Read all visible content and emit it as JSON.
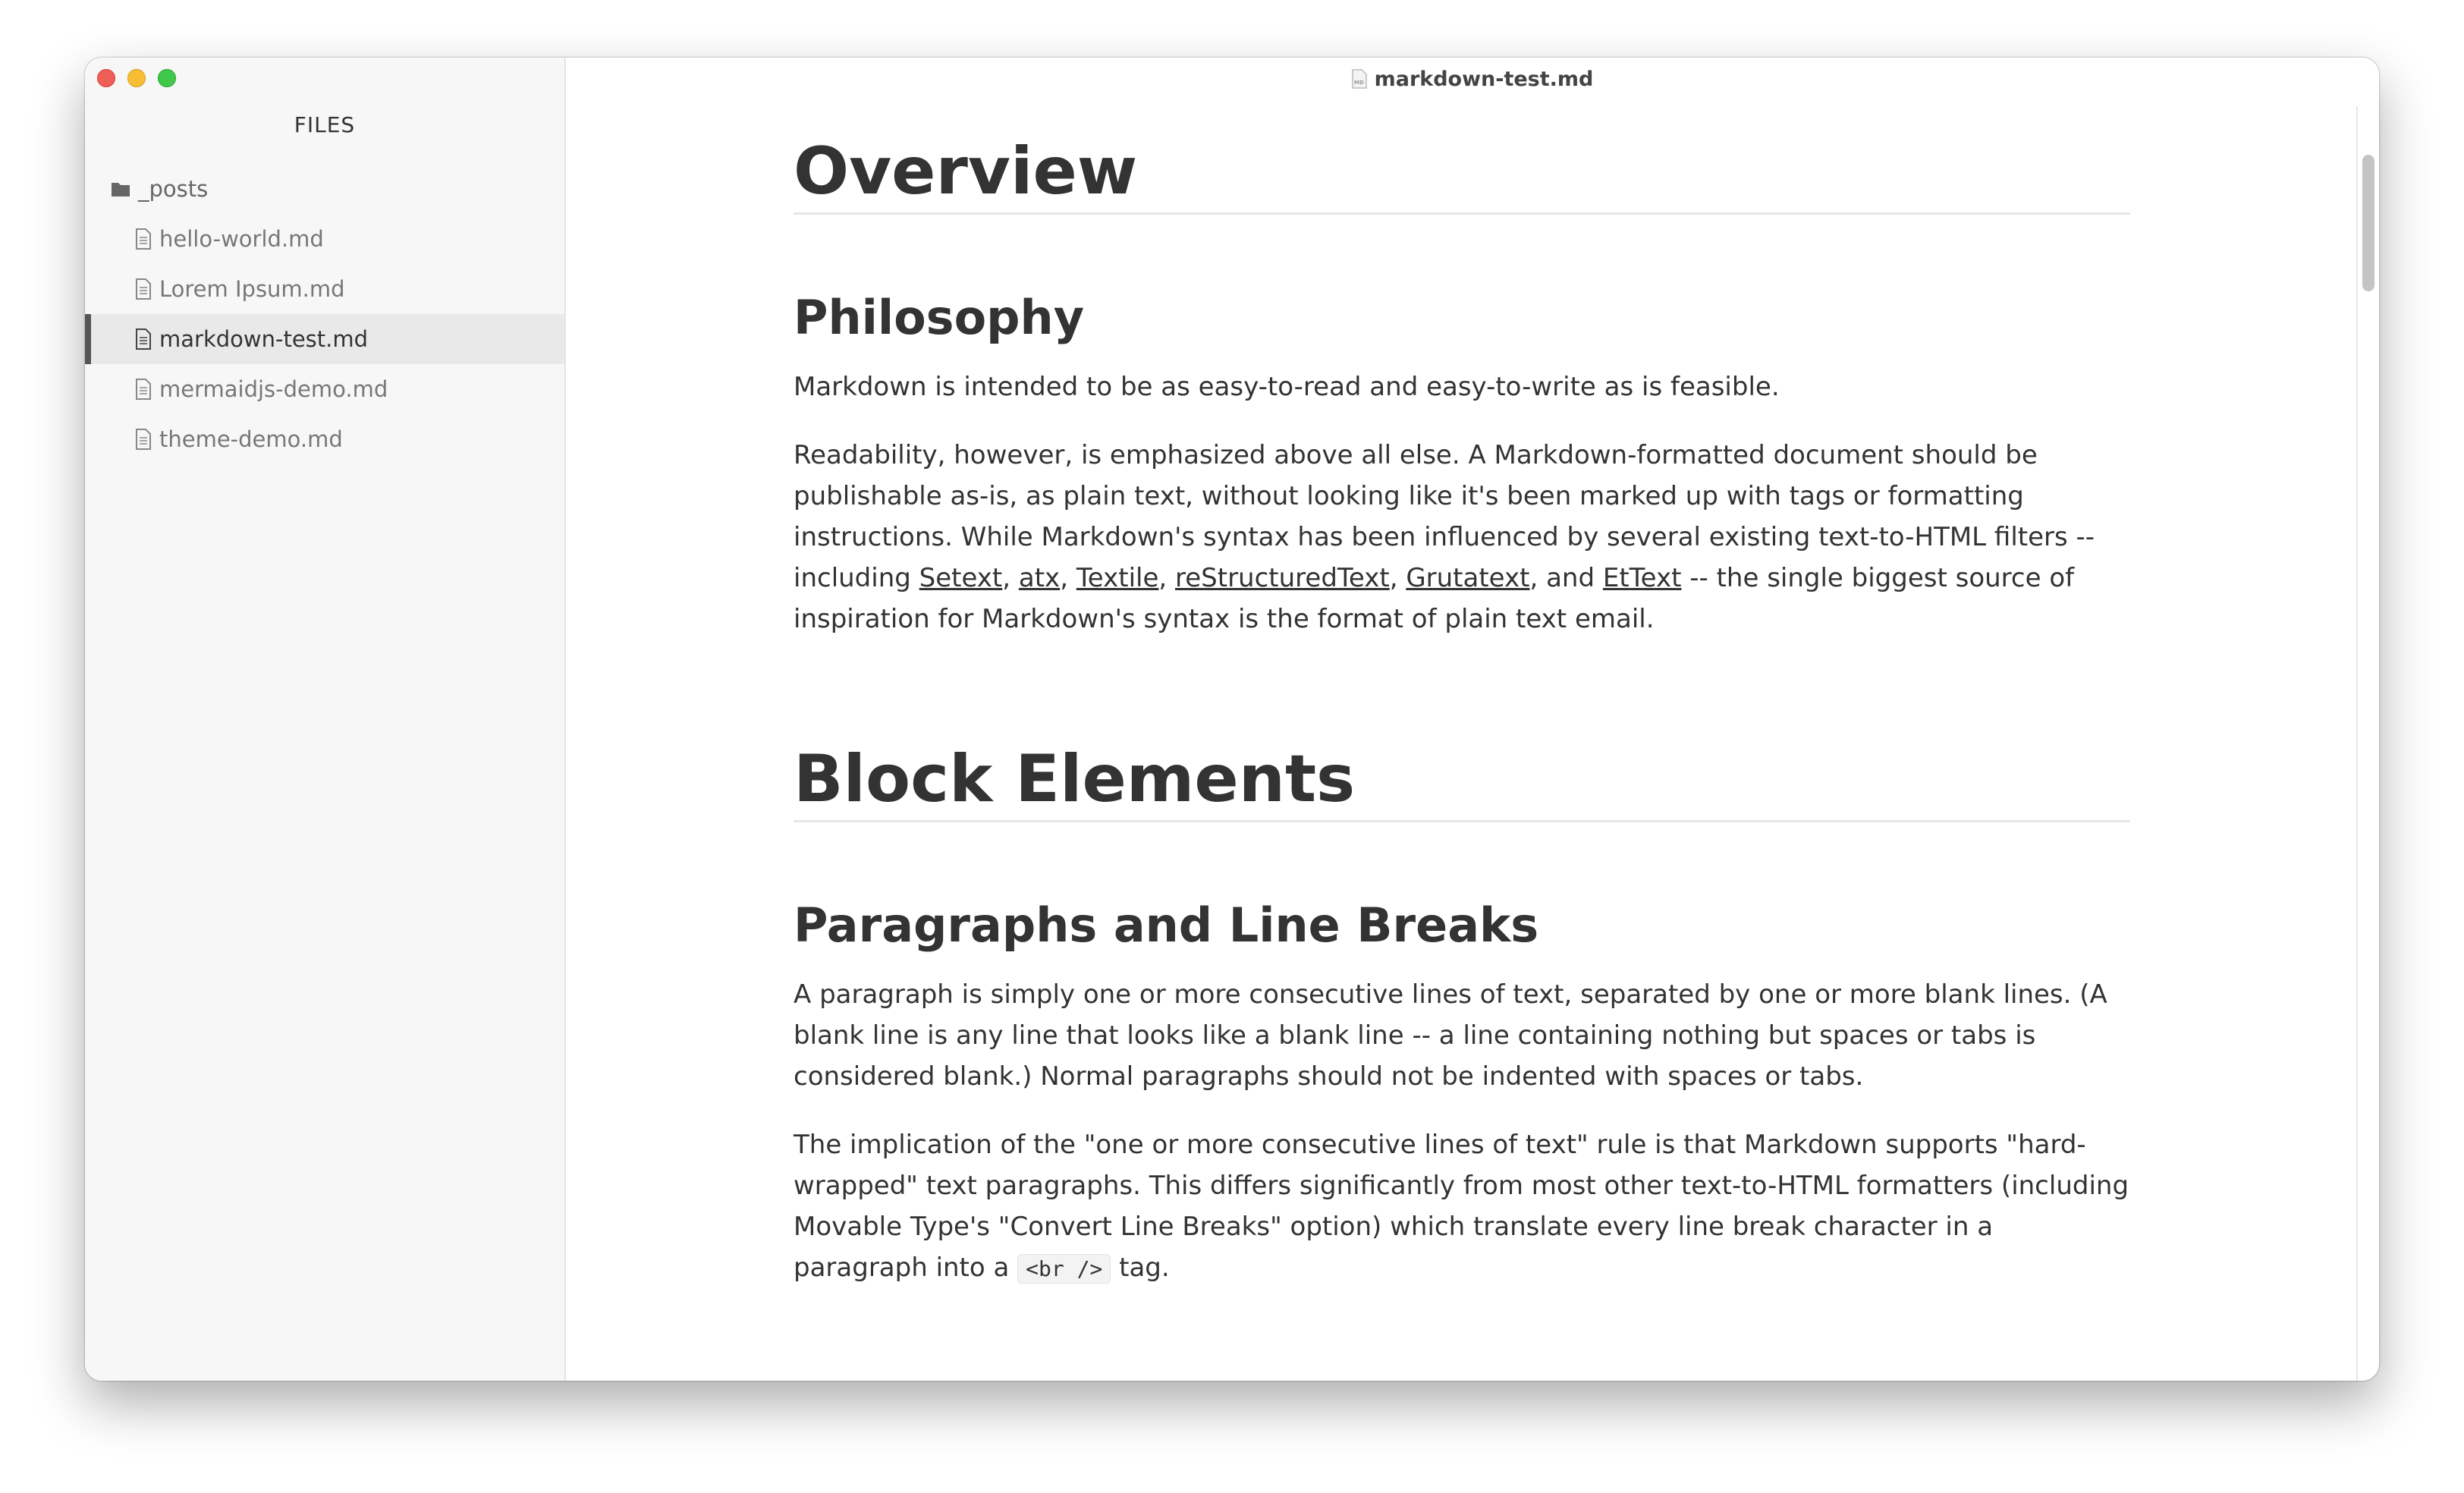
{
  "window": {
    "title": "markdown-test.md"
  },
  "sidebar": {
    "header": "FILES",
    "folder": "_posts",
    "files": [
      {
        "label": "hello-world.md"
      },
      {
        "label": "Lorem Ipsum.md"
      },
      {
        "label": "markdown-test.md",
        "active": true
      },
      {
        "label": "mermaidjs-demo.md"
      },
      {
        "label": "theme-demo.md"
      }
    ]
  },
  "doc": {
    "h1_overview": "Overview",
    "h2_philosophy": "Philosophy",
    "p1": "Markdown is intended to be as easy-to-read and easy-to-write as is feasible.",
    "p2": {
      "a": "Readability, however, is emphasized above all else. A Markdown-formatted document should be publishable as-is, as plain text, without looking like it's been marked up with tags or formatting instructions. While Markdown's syntax has been influenced by several existing text-to-HTML filters -- including ",
      "links": [
        "Setext",
        "atx",
        "Textile",
        "reStructuredText",
        "Grutatext",
        "EtText"
      ],
      "sep": ", ",
      "and": ", and ",
      "b": " -- the single biggest source of inspiration for Markdown's syntax is the format of plain text email."
    },
    "h1_block": "Block Elements",
    "h2_paragraphs": "Paragraphs and Line Breaks",
    "p3": "A paragraph is simply one or more consecutive lines of text, separated by one or more blank lines. (A blank line is any line that looks like a blank line -- a line containing nothing but spaces or tabs is considered blank.) Normal paragraphs should not be indented with spaces or tabs.",
    "p4": {
      "a": "The implication of the \"one or more consecutive lines of text\" rule is that Markdown supports \"hard-wrapped\" text paragraphs. This differs significantly from most other text-to-HTML formatters (including Movable Type's \"Convert Line Breaks\" option) which translate every line break character in a paragraph into a ",
      "code": "<br />",
      "b": " tag."
    }
  }
}
